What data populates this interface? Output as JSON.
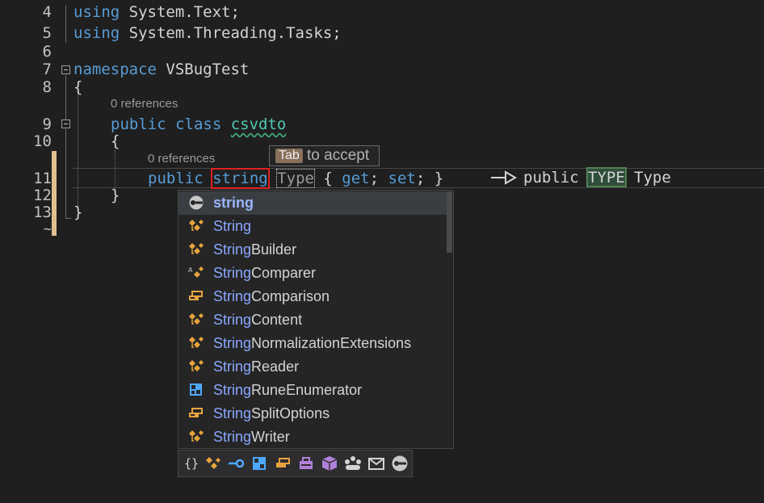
{
  "editor": {
    "lines": [
      {
        "num": "4",
        "code": [
          "using",
          " System.Text;"
        ]
      },
      {
        "num": "5",
        "code": [
          "using",
          " System.Threading.Tasks;"
        ]
      },
      {
        "num": "6"
      },
      {
        "num": "7",
        "code": [
          "namespace",
          " VSBugTest"
        ]
      },
      {
        "num": "8",
        "code": [
          "{"
        ]
      },
      {
        "num": "9",
        "code": [
          "public",
          " class",
          " csvdto"
        ]
      },
      {
        "num": "10",
        "code": [
          "{"
        ]
      },
      {
        "num": "11",
        "code": [
          "public",
          " string",
          "Type",
          " { ",
          "get",
          "; ",
          "set",
          "; }"
        ]
      },
      {
        "num": "12",
        "code": [
          "}"
        ]
      },
      {
        "num": "13",
        "code": [
          "}"
        ]
      },
      {
        "num": "~"
      }
    ],
    "references_label": "0 references",
    "line7_prefix": "namespace",
    "line7_name": "VSBugTest",
    "line9_name": "csvdto",
    "highlighted_word": "string",
    "ghost_word": "Type"
  },
  "tab_hint": {
    "key": "Tab",
    "text": "to accept"
  },
  "preview": {
    "arrow": "-▷",
    "before": "public",
    "type_token": "TYPE",
    "after": "Type"
  },
  "completion": {
    "items": [
      {
        "label_hl": "string",
        "label_rest": "",
        "icon": "keyword-icon",
        "selected": true
      },
      {
        "label_hl": "String",
        "label_rest": "",
        "icon": "class-icon"
      },
      {
        "label_hl": "String",
        "label_rest": "Builder",
        "icon": "class-icon"
      },
      {
        "label_hl": "String",
        "label_rest": "Comparer",
        "icon": "abstract-class-icon"
      },
      {
        "label_hl": "String",
        "label_rest": "Comparison",
        "icon": "enum-icon"
      },
      {
        "label_hl": "String",
        "label_rest": "Content",
        "icon": "class-icon"
      },
      {
        "label_hl": "String",
        "label_rest": "NormalizationExtensions",
        "icon": "class-icon"
      },
      {
        "label_hl": "String",
        "label_rest": "Reader",
        "icon": "class-icon"
      },
      {
        "label_hl": "String",
        "label_rest": "RuneEnumerator",
        "icon": "struct-icon"
      },
      {
        "label_hl": "String",
        "label_rest": "SplitOptions",
        "icon": "enum-icon"
      },
      {
        "label_hl": "String",
        "label_rest": "Writer",
        "icon": "class-icon"
      }
    ],
    "filters": [
      "namespace-filter-icon",
      "class-filter-icon",
      "interface-filter-icon",
      "struct-filter-icon",
      "enum-filter-icon",
      "delegate-filter-icon",
      "module-filter-icon",
      "intrinsic-filter-icon",
      "extension-method-filter-icon",
      "snippet-filter-icon",
      "keyword-filter-icon"
    ]
  },
  "colors": {
    "keyword": "#569cd6",
    "type": "#4ec9b0",
    "highlight_border": "#e02020",
    "accent_blue": "#8aa8ff",
    "icon_orange": "#e8a33d",
    "icon_purple": "#b180d7",
    "icon_blue": "#4fa8ff"
  }
}
